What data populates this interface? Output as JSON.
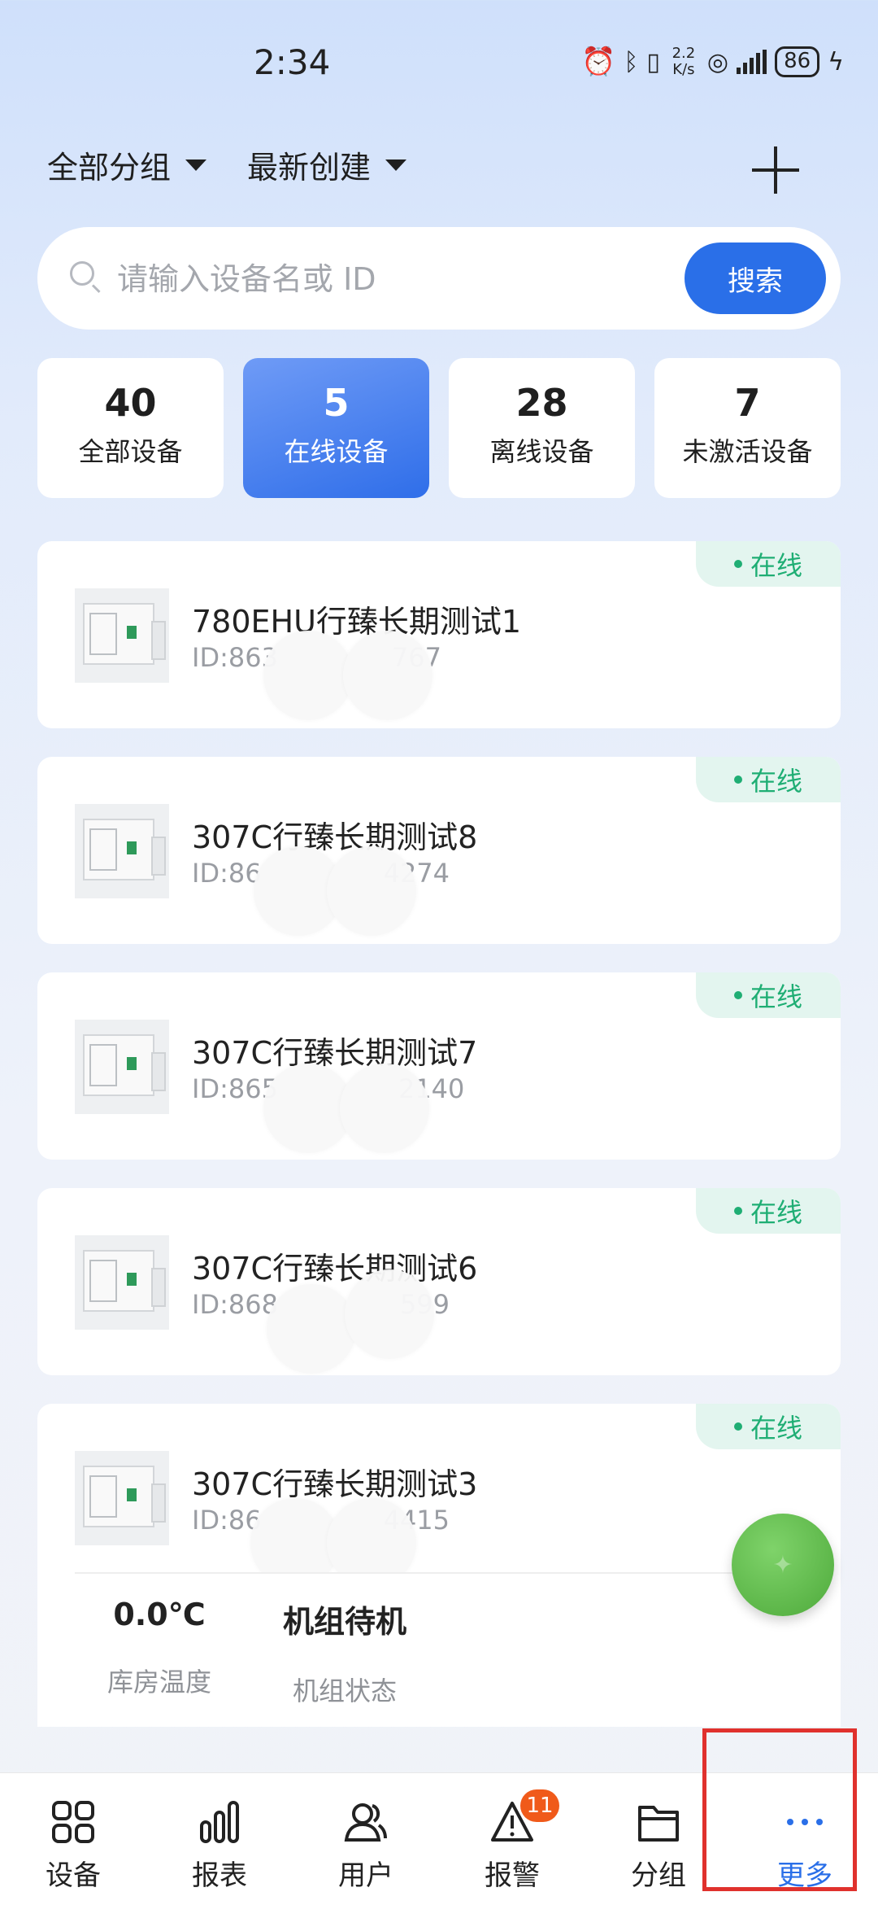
{
  "status_bar": {
    "time": "2:34",
    "net_speed_value": "2.2",
    "net_speed_unit": "K/s",
    "battery": "86",
    "icons": [
      "alarm-icon",
      "bluetooth-icon",
      "vibrate-icon",
      "hotspot-icon",
      "5g-signal-icon",
      "charging-icon"
    ]
  },
  "filters": {
    "group": "全部分组",
    "sort": "最新创建"
  },
  "search": {
    "placeholder": "请输入设备名或 ID",
    "button": "搜索"
  },
  "stats": [
    {
      "count": "40",
      "label": "全部设备"
    },
    {
      "count": "5",
      "label": "在线设备"
    },
    {
      "count": "28",
      "label": "离线设备"
    },
    {
      "count": "7",
      "label": "未激活设备"
    }
  ],
  "devices": [
    {
      "name": "780EHU行臻长期测试1",
      "id_prefix": "ID:863",
      "id_suffix": "767",
      "status": "在线"
    },
    {
      "name": "307C行臻长期测试8",
      "id_prefix": "ID:86",
      "id_suffix": "4274",
      "status": "在线"
    },
    {
      "name": "307C行臻长期测试7",
      "id_prefix": "ID:865",
      "id_suffix": "2140",
      "status": "在线"
    },
    {
      "name": "307C行臻长期测试6",
      "id_prefix": "ID:868",
      "id_suffix": "599",
      "status": "在线"
    },
    {
      "name": "307C行臻长期测试3",
      "id_prefix": "ID:86",
      "id_suffix": "4415",
      "status": "在线"
    }
  ],
  "device_detail": {
    "temperature_value": "0.0℃",
    "temperature_label": "库房温度",
    "unit_state_value": "机组待机",
    "unit_state_label": "机组状态"
  },
  "fab": {
    "icon": "ai-assistant-icon"
  },
  "nav": {
    "items": [
      {
        "label": "设备",
        "icon": "grid-icon"
      },
      {
        "label": "报表",
        "icon": "bar-chart-icon"
      },
      {
        "label": "用户",
        "icon": "users-icon"
      },
      {
        "label": "报警",
        "icon": "alert-icon",
        "badge": "11"
      },
      {
        "label": "分组",
        "icon": "folder-icon"
      },
      {
        "label": "更多",
        "icon": "more-icon"
      }
    ],
    "active_index": 5
  },
  "colors": {
    "accent": "#2a6fe8",
    "online": "#1fae74",
    "badge": "#f05a1a",
    "highlight": "#e0312d",
    "fab": "#5cb549"
  }
}
